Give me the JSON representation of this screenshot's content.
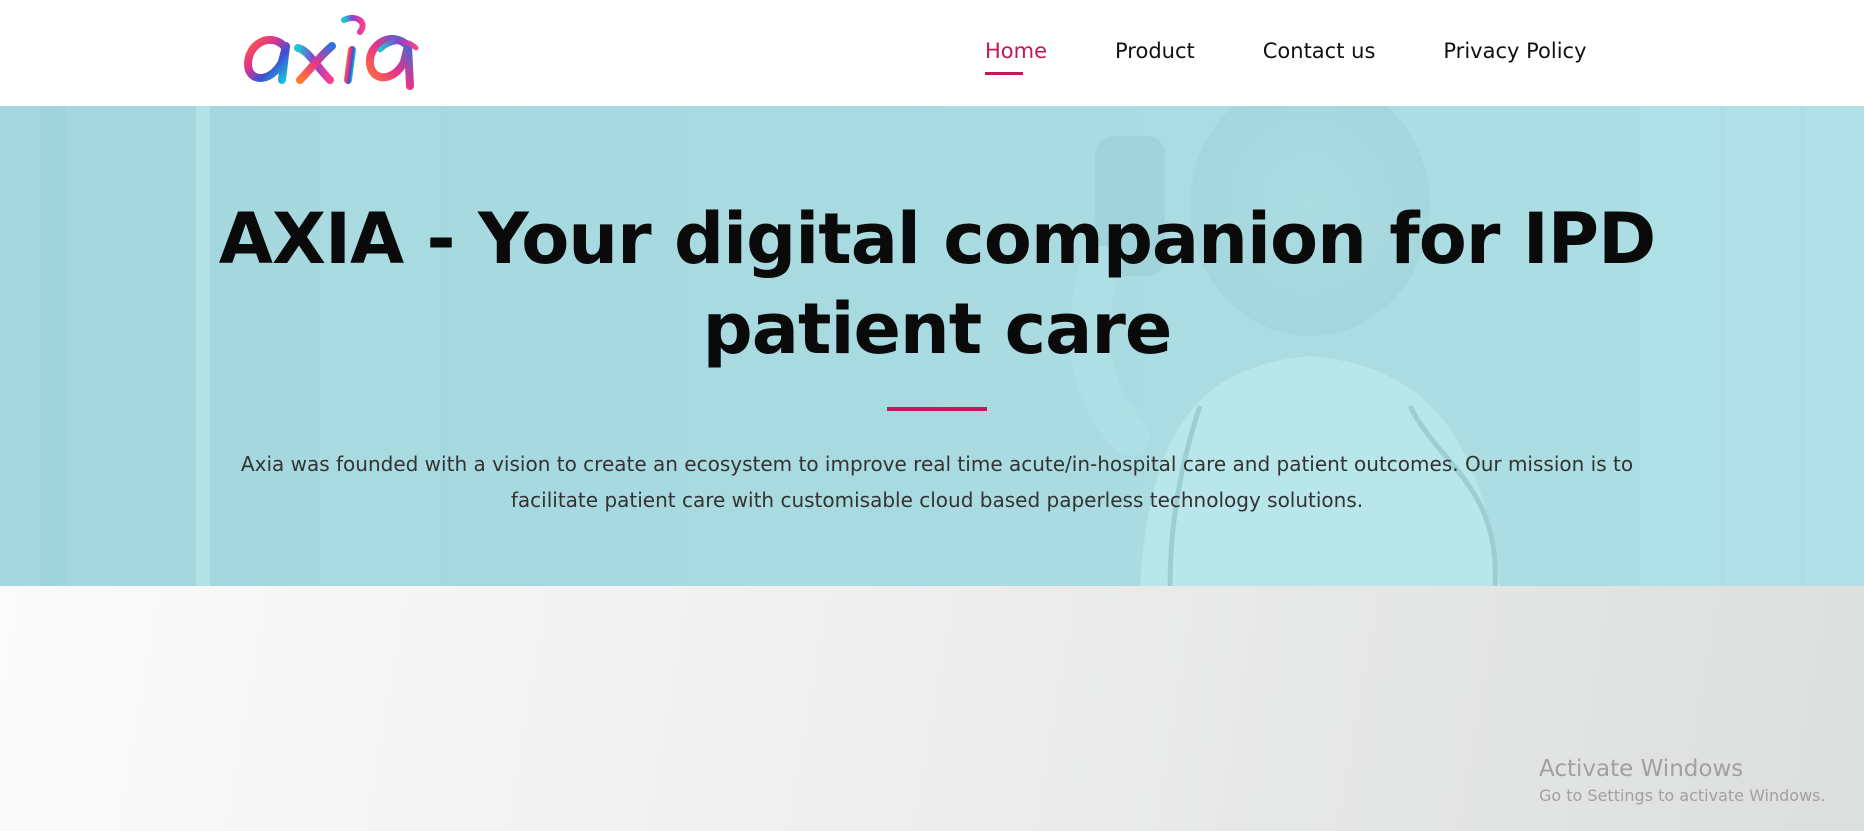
{
  "brand": {
    "logo_text": "axia",
    "accent_color": "#c2185b"
  },
  "nav": {
    "items": [
      {
        "label": "Home",
        "active": true
      },
      {
        "label": "Product",
        "active": false
      },
      {
        "label": "Contact us",
        "active": false
      },
      {
        "label": "Privacy Policy",
        "active": false
      }
    ]
  },
  "hero": {
    "title": "AXIA - Your digital companion for IPD patient care",
    "description": "Axia was founded with a vision to create an ecosystem to improve real time acute/in-hospital care and patient outcomes. Our mission is to facilitate patient care with customisable cloud based paperless technology solutions.",
    "background_image": "doctor-with-phone-photo",
    "overlay_color": "#b2e3e9"
  },
  "watermark": {
    "title": "Activate Windows",
    "subtitle": "Go to Settings to activate Windows."
  }
}
